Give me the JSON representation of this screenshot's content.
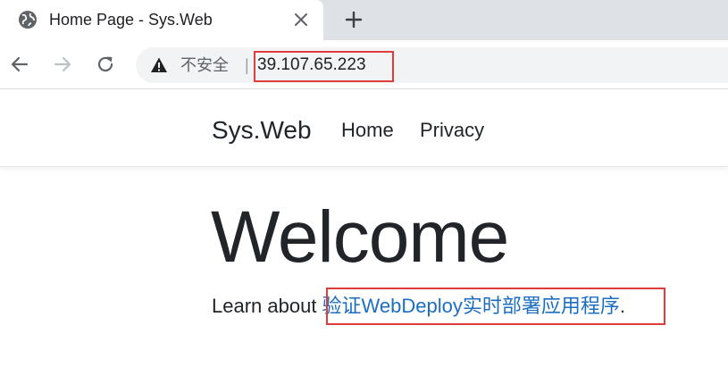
{
  "browser": {
    "tab": {
      "title": "Home Page - Sys.Web",
      "favicon": "globe-icon",
      "close_icon": "close-icon"
    },
    "new_tab_icon": "plus-icon",
    "toolbar": {
      "back_icon": "arrow-left-icon",
      "forward_icon": "arrow-right-icon",
      "reload_icon": "reload-icon"
    },
    "omnibox": {
      "security_icon": "warning-triangle-icon",
      "security_label": "不安全",
      "separator": "|",
      "url": "39.107.65.223"
    }
  },
  "site": {
    "brand": "Sys.Web",
    "nav": [
      {
        "label": "Home"
      },
      {
        "label": "Privacy"
      }
    ],
    "heading": "Welcome",
    "learn_prefix": "Learn about ",
    "learn_link": "验证WebDeploy实时部署应用程序",
    "learn_suffix": "."
  },
  "colors": {
    "tabstrip_bg": "#dee1e6",
    "omnibox_bg": "#f1f3f4",
    "link": "#1b6ec2",
    "annotation_red": "#e03c3c",
    "text": "#212529"
  }
}
